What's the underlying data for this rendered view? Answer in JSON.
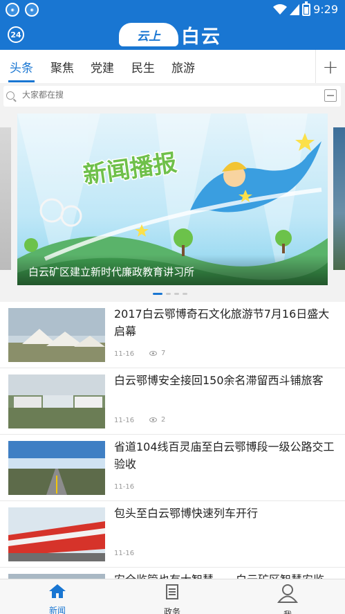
{
  "status_bar": {
    "time": "9:29"
  },
  "header": {
    "badge": "24",
    "logo_cloud_text": "云上",
    "logo_text": "白云"
  },
  "tabs": [
    {
      "label": "头条",
      "active": true
    },
    {
      "label": "聚焦",
      "active": false
    },
    {
      "label": "党建",
      "active": false
    },
    {
      "label": "民生",
      "active": false
    },
    {
      "label": "旅游",
      "active": false
    }
  ],
  "search": {
    "placeholder": "大家都在搜"
  },
  "banner": {
    "caption": "白云矿区建立新时代廉政教育讲习所",
    "image_text": "新闻播报",
    "page_count": 4,
    "active_page": 1
  },
  "news": [
    {
      "title": "2017白云鄂博奇石文化旅游节7月16日盛大启幕",
      "date": "11-16",
      "views": "7",
      "thumb": "tents"
    },
    {
      "title": "白云鄂博安全接回150余名滞留西斗铺旅客",
      "date": "11-16",
      "views": "2",
      "thumb": "buses"
    },
    {
      "title": "省道104线百灵庙至白云鄂博段一级公路交工验收",
      "date": "11-16",
      "views": "",
      "thumb": "road"
    },
    {
      "title": "包头至白云鄂博快速列车开行",
      "date": "11-16",
      "views": "",
      "thumb": "train"
    },
    {
      "title": "安全监管也有大智慧——白云矿区智慧安监",
      "date": "",
      "views": "",
      "thumb": "other"
    }
  ],
  "bottom_nav": [
    {
      "label": "新闻",
      "icon": "home-icon",
      "active": true
    },
    {
      "label": "政务",
      "icon": "document-icon",
      "active": false
    },
    {
      "label": "我",
      "icon": "user-icon",
      "active": false
    }
  ],
  "colors": {
    "primary": "#1976d2",
    "text": "#222222",
    "muted": "#999999"
  }
}
